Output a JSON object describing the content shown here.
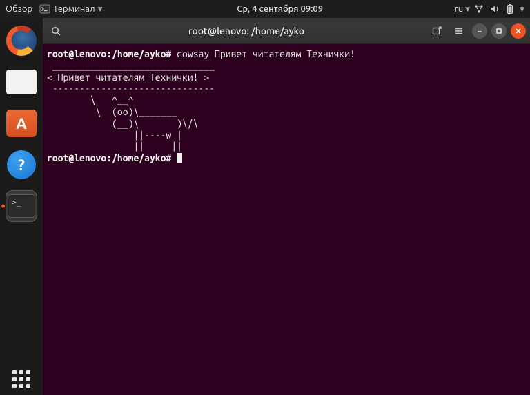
{
  "top_panel": {
    "activities": "Обзор",
    "app_menu": "Терминал",
    "datetime": "Ср, 4 сентября  09:09",
    "lang": "ru"
  },
  "dock": {
    "items": [
      {
        "name": "firefox"
      },
      {
        "name": "files"
      },
      {
        "name": "software",
        "glyph": "A"
      },
      {
        "name": "help",
        "glyph": "?"
      },
      {
        "name": "terminal",
        "glyph": ">_",
        "active": true
      }
    ]
  },
  "window": {
    "title": "root@lenovo: /home/ayko"
  },
  "terminal": {
    "prompt1": "root@lenovo:/home/ayko#",
    "command": "cowsay Привет читателям Технички!",
    "output": " ______________________________\n< Привет читателям Технички! >\n ------------------------------\n        \\   ^__^\n         \\  (oo)\\_______\n            (__)\\       )\\/\\\n                ||----w |\n                ||     ||",
    "prompt2": "root@lenovo:/home/ayko#"
  }
}
